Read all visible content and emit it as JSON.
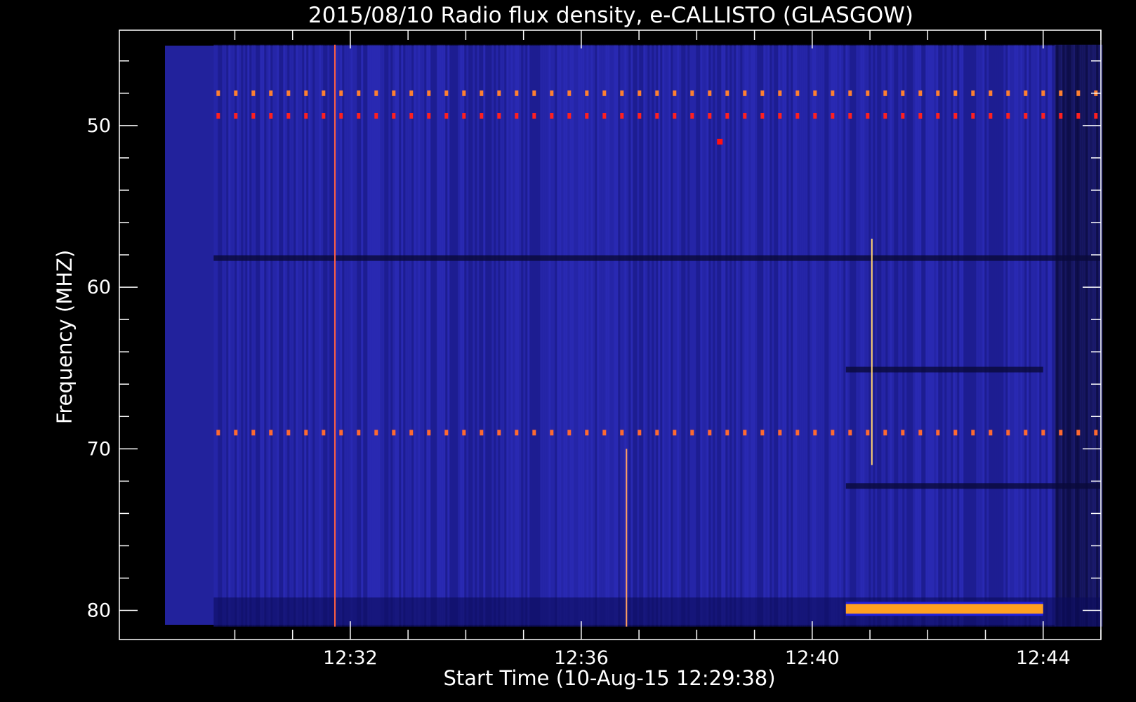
{
  "chart_data": {
    "type": "heatmap",
    "title": "2015/08/10  Radio flux density, e-CALLISTO (GLASGOW)",
    "xlabel": "Start Time (10-Aug-15 12:29:38)",
    "ylabel": "Frequency (MHZ)",
    "x_start": "12:29:38",
    "xlim": [
      "12:28:00",
      "12:45:00"
    ],
    "x_data_range": [
      "12:29:38",
      "12:45:00"
    ],
    "x_ticks": [
      "12:32",
      "12:36",
      "12:40",
      "12:44"
    ],
    "ylim": [
      81.8,
      44.1
    ],
    "y_data_range": [
      81.0,
      45.0
    ],
    "y_ticks": [
      50,
      60,
      70,
      80
    ],
    "y_axis_inverted": true,
    "colormap": [
      "#000000",
      "#10108a",
      "#2a2ac8",
      "#ff1010",
      "#ffa020",
      "#ffff80"
    ],
    "background_level": "blue",
    "features": [
      {
        "kind": "dotted-line",
        "freq": 48.0,
        "start": "12:29:38",
        "end": "12:45:00",
        "color": "#ff8030"
      },
      {
        "kind": "dotted-line",
        "freq": 49.4,
        "start": "12:29:38",
        "end": "12:45:00",
        "color": "#ff2020"
      },
      {
        "kind": "dark-band",
        "freq": 58.2,
        "start": "12:29:38",
        "end": "12:45:00"
      },
      {
        "kind": "dark-band",
        "freq": 65.1,
        "start": "12:40:35",
        "end": "12:44:00"
      },
      {
        "kind": "dark-band",
        "freq": 72.3,
        "start": "12:40:35",
        "end": "12:45:00"
      },
      {
        "kind": "dotted-line",
        "freq": 69.0,
        "start": "12:29:38",
        "end": "12:45:00",
        "color": "#ff6a30"
      },
      {
        "kind": "vertical-spike",
        "time": "12:36:47",
        "freq_from": 70.0,
        "freq_to": 81.0,
        "color": "#ffa060"
      },
      {
        "kind": "vertical-spike",
        "time": "12:31:44",
        "freq_from": 45.0,
        "freq_to": 81.0,
        "color": "#ff6040"
      },
      {
        "kind": "vertical-spike",
        "time": "12:41:02",
        "freq_from": 57.0,
        "freq_to": 71.0,
        "color": "#ffd070"
      },
      {
        "kind": "emission-band",
        "freq_from": 79.6,
        "freq_to": 80.2,
        "start": "12:40:35",
        "end": "12:44:00",
        "color": "#ffa020"
      },
      {
        "kind": "spot",
        "freq": 51.0,
        "time": "12:38:24",
        "color": "#ff1010"
      }
    ]
  }
}
